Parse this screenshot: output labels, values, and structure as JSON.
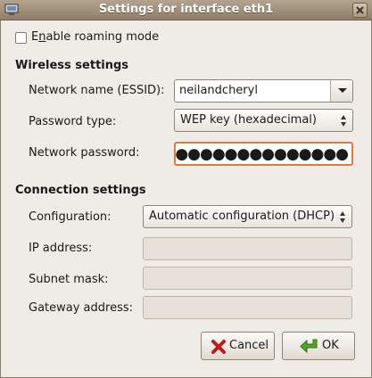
{
  "window": {
    "title": "Settings for interface eth1"
  },
  "roaming": {
    "label_pre": "E",
    "label_ul": "n",
    "label_post": "able roaming mode",
    "checked": false
  },
  "wireless": {
    "heading": "Wireless settings",
    "network_name_label": "Network name (ESSID):",
    "network_name_value": "neilandcheryl",
    "password_type_label": "Password type:",
    "password_type_value": "WEP key (hexadecimal)",
    "network_password_label": "Network password:",
    "network_password_value": "●●●●●●●●●●●●●●●●●●●●"
  },
  "connection": {
    "heading": "Connection settings",
    "configuration_label": "Configuration:",
    "configuration_value": "Automatic configuration (DHCP)",
    "ip_label": "IP address:",
    "subnet_label": "Subnet mask:",
    "gateway_label": "Gateway address:",
    "ip_value": "",
    "subnet_value": "",
    "gateway_value": ""
  },
  "buttons": {
    "cancel": "Cancel",
    "ok": "OK"
  },
  "colors": {
    "focus_border": "#e07b3c",
    "ok_arrow": "#4ea82a",
    "cancel_x": "#c0191b"
  }
}
